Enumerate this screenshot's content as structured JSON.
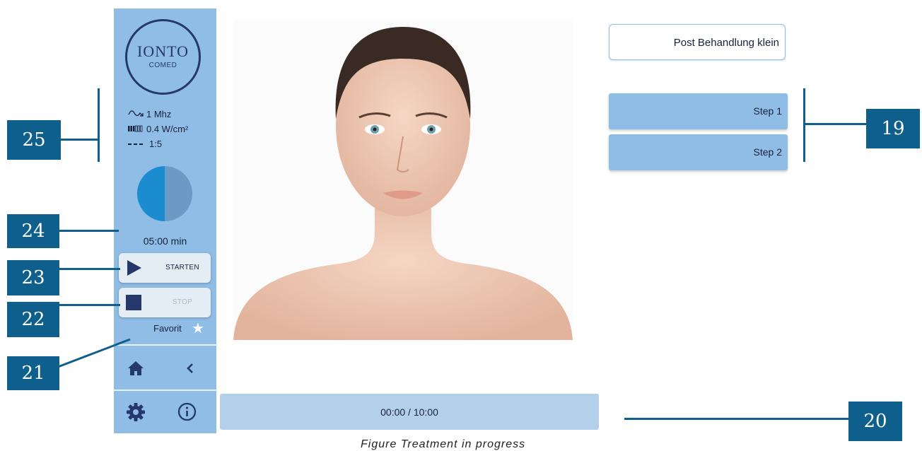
{
  "sidebar": {
    "logo": {
      "main": "IONTO",
      "sub": "COMED"
    },
    "params": {
      "frequency": "1 Mhz",
      "intensity": "0.4 W/cm²",
      "ratio": "1:5"
    },
    "timer": "05:00 min",
    "start_label": "STARTEN",
    "stop_label": "STOP",
    "favorite_label": "Favorit"
  },
  "main": {
    "progress_text": "00:00 / 10:00"
  },
  "right": {
    "preset_label": "Post Behandlung klein",
    "steps": [
      {
        "label": "Step 1"
      },
      {
        "label": "Step 2"
      }
    ]
  },
  "callouts": {
    "n19": "19",
    "n20": "20",
    "n21": "21",
    "n22": "22",
    "n23": "23",
    "n24": "24",
    "n25": "25"
  },
  "caption": "Figure Treatment in progress",
  "colors": {
    "sidebar": "#8fbde6",
    "callout": "#0f5f8c",
    "dark_text": "#26376b",
    "pie_left": "#1b8ccf",
    "pie_right": "#6b9ac4"
  }
}
